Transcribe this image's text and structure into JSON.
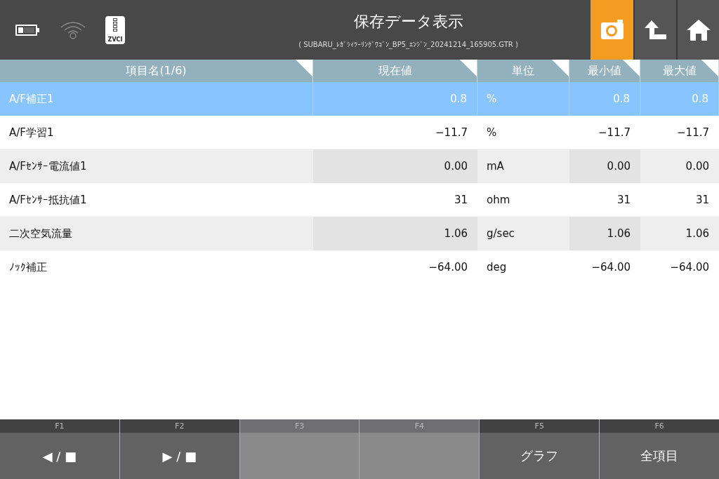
{
  "header": {
    "title": "保存データ表示",
    "subtitle": "( SUBARU_ﾚｶﾞｼｨﾂｰﾘﾝｸﾞﾜｺﾞﾝ_BP5_ｴﾝｼﾞﾝ_20241214_165905.GTR )",
    "device_label": "ZVCI",
    "buttons": [
      {
        "kind": "camera",
        "selected": true
      },
      {
        "kind": "back",
        "selected": false
      },
      {
        "kind": "home",
        "selected": false
      }
    ]
  },
  "table": {
    "columns": [
      {
        "label": "項目名(1/6)",
        "kind": "name"
      },
      {
        "label": "現在値",
        "kind": "number"
      },
      {
        "label": "単位",
        "kind": "unit"
      },
      {
        "label": "最小値",
        "kind": "number"
      },
      {
        "label": "最大値",
        "kind": "plain"
      }
    ],
    "rows": [
      {
        "selected": true,
        "cells": [
          "A/F補正1",
          "0.8",
          "%",
          "0.8",
          "0.8"
        ]
      },
      {
        "selected": false,
        "cells": [
          "A/F学習1",
          "−11.7",
          "%",
          "−11.7",
          "−11.7"
        ]
      },
      {
        "selected": false,
        "cells": [
          "A/Fｾﾝｻｰ電流値1",
          "0.00",
          "mA",
          "0.00",
          "0.00"
        ]
      },
      {
        "selected": false,
        "cells": [
          "A/Fｾﾝｻｰ抵抗値1",
          "31",
          "ohm",
          "31",
          "31"
        ]
      },
      {
        "selected": false,
        "cells": [
          "二次空気流量",
          "1.06",
          "g/sec",
          "1.06",
          "1.06"
        ]
      },
      {
        "selected": false,
        "cells": [
          "ﾉｯｸ補正",
          "−64.00",
          "deg",
          "−64.00",
          "−64.00"
        ]
      }
    ]
  },
  "function_keys": [
    {
      "key": "F1",
      "label": "◀ / ■",
      "disabled": false
    },
    {
      "key": "F2",
      "label": "▶ / ■",
      "disabled": false
    },
    {
      "key": "F3",
      "disabled": true
    },
    {
      "key": "F4",
      "disabled": true
    },
    {
      "key": "F5",
      "label": "グラフ",
      "disabled": false
    },
    {
      "key": "F6",
      "label": "全項目",
      "disabled": false
    }
  ]
}
